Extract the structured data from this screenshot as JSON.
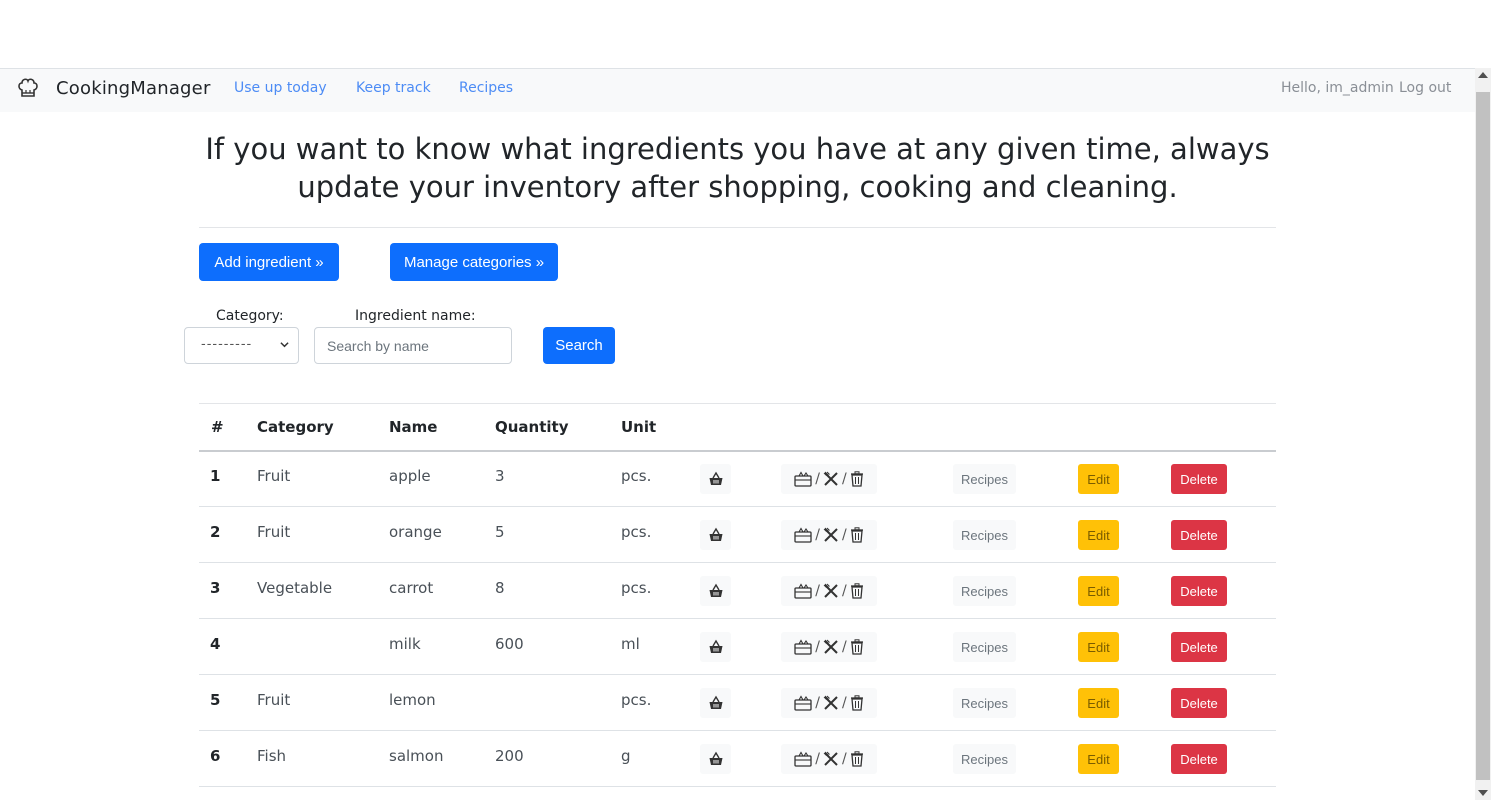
{
  "nav": {
    "brand": "CookingManager",
    "links": [
      "Use up today",
      "Keep track",
      "Recipes"
    ],
    "greeting": "Hello, im_admin",
    "logout": "Log out"
  },
  "headline": "If you want to know what ingredients you have at any given time, always update your inventory after shopping, cooking and cleaning.",
  "actions": {
    "add_ingredient": "Add ingredient »",
    "manage_categories": "Manage categories »"
  },
  "filter": {
    "category_label": "Category:",
    "category_value": "---------",
    "name_label": "Ingredient name:",
    "name_placeholder": "Search by name",
    "search_button": "Search"
  },
  "table": {
    "headers": [
      "#",
      "Category",
      "Name",
      "Quantity",
      "Unit"
    ],
    "row_action_labels": {
      "recipes": "Recipes",
      "edit": "Edit",
      "delete": "Delete"
    },
    "rows": [
      {
        "num": "1",
        "category": "Fruit",
        "name": "apple",
        "quantity": "3",
        "unit": "pcs."
      },
      {
        "num": "2",
        "category": "Fruit",
        "name": "orange",
        "quantity": "5",
        "unit": "pcs."
      },
      {
        "num": "3",
        "category": "Vegetable",
        "name": "carrot",
        "quantity": "8",
        "unit": "pcs."
      },
      {
        "num": "4",
        "category": "",
        "name": "milk",
        "quantity": "600",
        "unit": "ml"
      },
      {
        "num": "5",
        "category": "Fruit",
        "name": "lemon",
        "quantity": "",
        "unit": "pcs."
      },
      {
        "num": "6",
        "category": "Fish",
        "name": "salmon",
        "quantity": "200",
        "unit": "g"
      }
    ]
  },
  "icons": {
    "brand": "chef-hat-icon",
    "shopping": "shopping-basket-icon",
    "use_up": "fridge-icon",
    "cooking": "utensils-icon",
    "waste": "trash-icon"
  },
  "colors": {
    "primary": "#0d6efd",
    "warning": "#ffc107",
    "danger": "#dc3545",
    "link": "#4d8cf5"
  }
}
